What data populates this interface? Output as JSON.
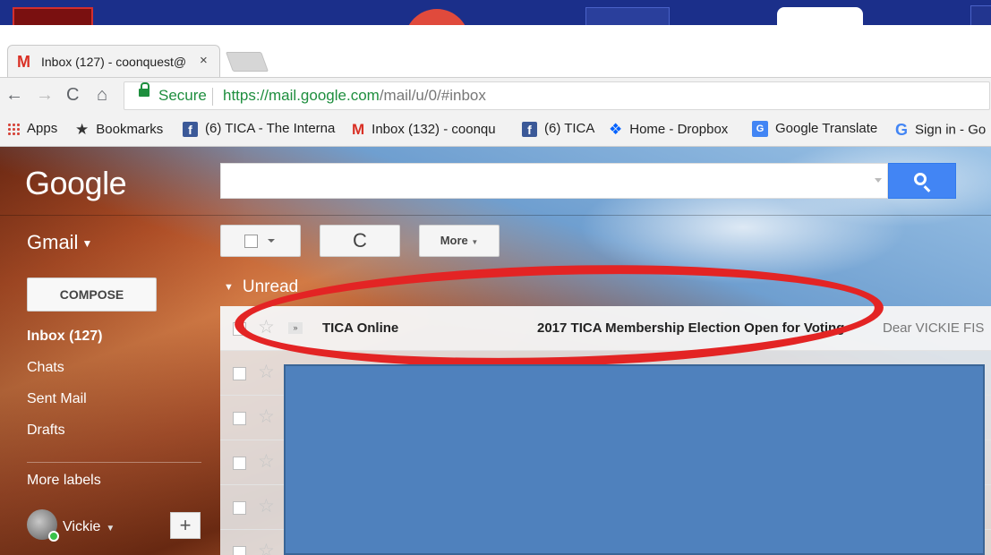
{
  "browser": {
    "tab": {
      "title": "Inbox (127) - coonquest@",
      "close": "×"
    },
    "nav": {
      "back": "←",
      "forward": "→",
      "reload": "C",
      "home": "⌂"
    },
    "omnibox": {
      "secure_label": "Secure",
      "url_host": "https://mail.google.com",
      "url_path": "/mail/u/0/#inbox"
    },
    "bookmarks": [
      {
        "label": "Apps",
        "icon": "apps-grid-icon"
      },
      {
        "label": "Bookmarks",
        "icon": "star-icon"
      },
      {
        "label": "(6) TICA - The Interna",
        "icon": "facebook-icon"
      },
      {
        "label": "Inbox (132) - coonqu",
        "icon": "gmail-icon"
      },
      {
        "label": "(6) TICA",
        "icon": "facebook-icon"
      },
      {
        "label": "Home - Dropbox",
        "icon": "dropbox-icon"
      },
      {
        "label": "Google Translate",
        "icon": "translate-icon"
      },
      {
        "label": "Sign in - Go",
        "icon": "google-icon"
      }
    ]
  },
  "gmail": {
    "logo": "Google",
    "app_label": "Gmail",
    "toolbar": {
      "more_label": "More",
      "refresh_glyph": "C"
    },
    "compose_label": "COMPOSE",
    "section_label": "Unread",
    "nav_items": [
      {
        "label": "Inbox (127)",
        "bold": true
      },
      {
        "label": "Chats"
      },
      {
        "label": "Sent Mail"
      },
      {
        "label": "Drafts"
      },
      {
        "label": "More labels"
      }
    ],
    "user_name": "Vickie",
    "add_label": "+",
    "messages": [
      {
        "sender": "TICA Online",
        "subject": "2017 TICA Membership Election Open for Voting",
        "snippet": "Dear VICKIE FIS"
      }
    ]
  },
  "colors": {
    "accent": "#4285f4",
    "annotation_red": "#e32424",
    "redaction_blue": "#4f81bd"
  }
}
